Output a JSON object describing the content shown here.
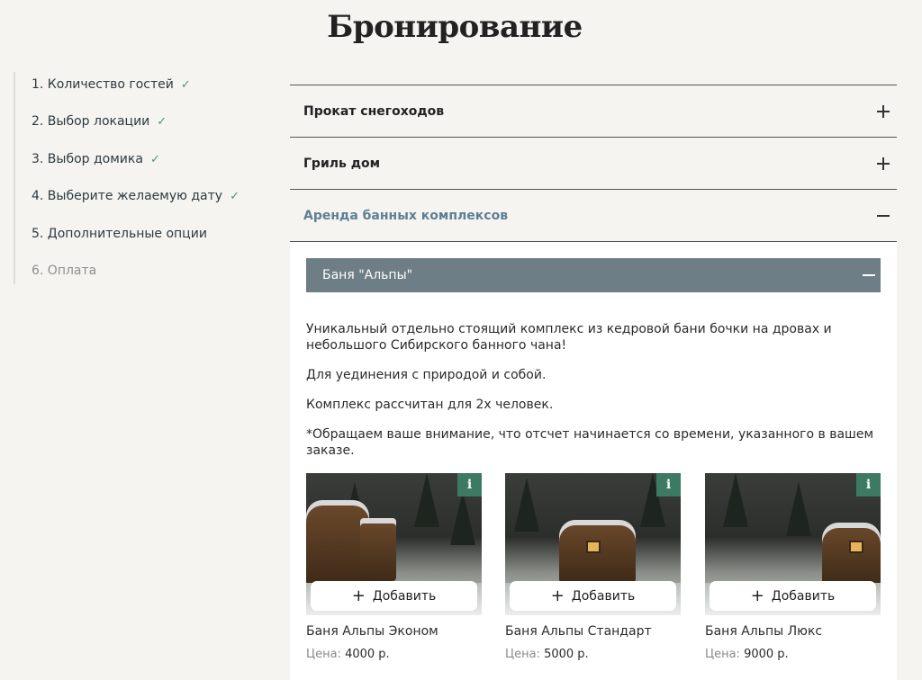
{
  "title": "Бронирование",
  "steps": [
    {
      "label": "1. Количество гостей",
      "done": true
    },
    {
      "label": "2. Выбор локации",
      "done": true
    },
    {
      "label": "3. Выбор домика",
      "done": true
    },
    {
      "label": "4. Выберите желаемую дату",
      "done": true
    },
    {
      "label": "5. Дополнительные опции",
      "done": false
    },
    {
      "label": "6. Оплата",
      "done": false
    }
  ],
  "check_glyph": "✓",
  "accordion": [
    {
      "title": "Прокат снегоходов",
      "open": false
    },
    {
      "title": "Гриль дом",
      "open": false
    },
    {
      "title": "Аренда банных комплексов",
      "open": true
    }
  ],
  "sub": {
    "title": "Баня \"Альпы\"",
    "paragraphs": [
      "Уникальный отдельно стоящий комплекс из кедровой бани бочки на дровах и небольшого Сибирского банного чана!",
      "Для уединения с природой и собой.",
      "Комплекс рассчитан для 2х человек.",
      "*Обращаем ваше внимание, что отсчет начинается со времени, указанного в вашем заказе."
    ]
  },
  "cards": [
    {
      "name": "Баня Альпы Эконом",
      "price_label": "Цена:",
      "price": "4000 р.",
      "add_label": "Добавить",
      "info": "i"
    },
    {
      "name": "Баня Альпы Стандарт",
      "price_label": "Цена:",
      "price": "5000 р.",
      "add_label": "Добавить",
      "info": "i"
    },
    {
      "name": "Баня Альпы Люкс",
      "price_label": "Цена:",
      "price": "9000 р.",
      "add_label": "Добавить",
      "info": "i"
    }
  ],
  "add_glyph": "+",
  "colors": {
    "background": "#f5f4f1",
    "accent_open": "#5d7f94",
    "sub_header": "#6e7e86",
    "check": "#4e9474",
    "info_badge": "#3c7a63"
  }
}
